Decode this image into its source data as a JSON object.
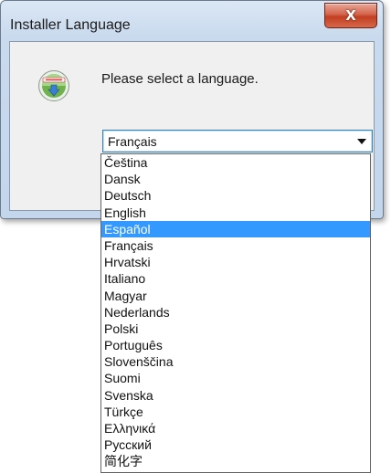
{
  "window": {
    "title": "Installer Language",
    "close_label": "X"
  },
  "dialog": {
    "icon": "installer-disc-icon",
    "prompt": "Please select a language.",
    "selected_value": "Français"
  },
  "language_list": {
    "highlighted": "Español",
    "items": [
      "Čeština",
      "Dansk",
      "Deutsch",
      "English",
      "Español",
      "Français",
      "Hrvatski",
      "Italiano",
      "Magyar",
      "Nederlands",
      "Polski",
      "Português",
      "Slovenščina",
      "Suomi",
      "Svenska",
      "Türkçe",
      "Ελληνικά",
      "Русский",
      "简化字"
    ]
  },
  "colors": {
    "highlight": "#3399ff",
    "close_button": "#c94a2d",
    "title_bar": "#c9daee"
  }
}
